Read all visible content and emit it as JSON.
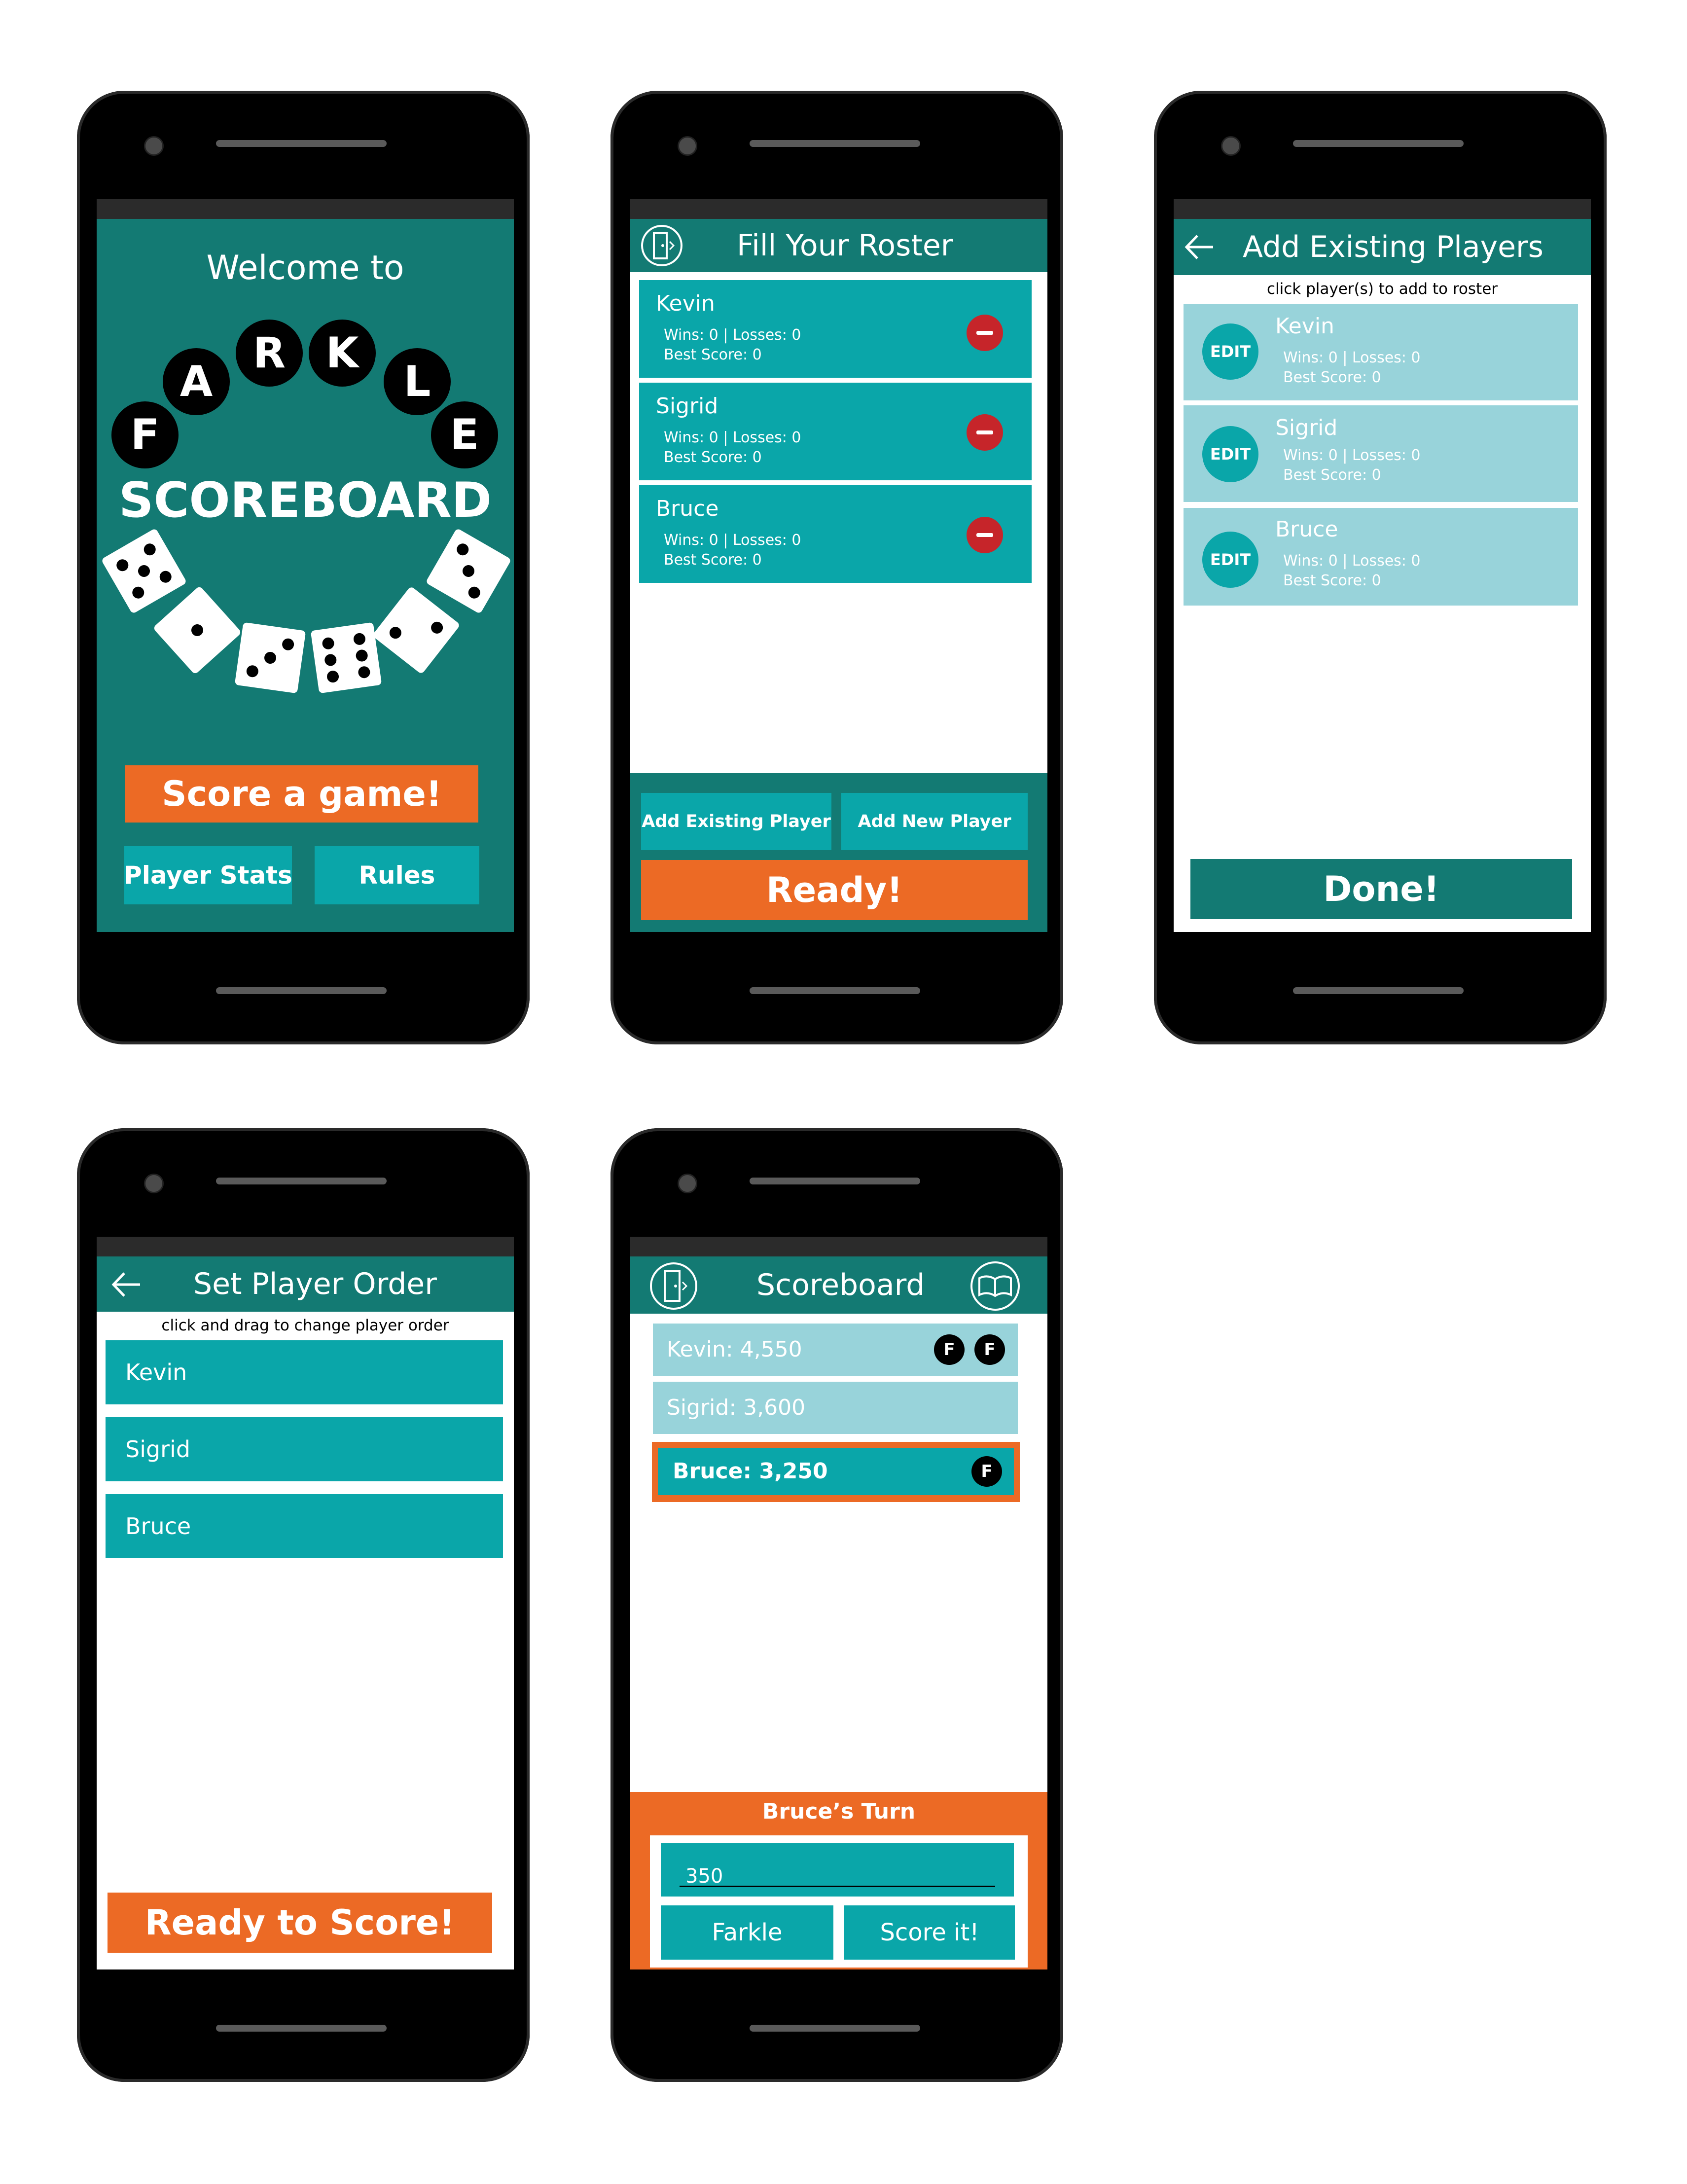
{
  "screens": {
    "welcome": {
      "welcome_text": "Welcome to",
      "letters": [
        "F",
        "A",
        "R",
        "K",
        "L",
        "E"
      ],
      "scoreboard_text": "SCOREBOARD",
      "score_button": "Score a game!",
      "stats_button": "Player Stats",
      "rules_button": "Rules"
    },
    "roster": {
      "title": "Fill Your Roster",
      "players": [
        {
          "name": "Kevin",
          "record": "Wins: 0   |   Losses: 0",
          "best": "Best Score: 0"
        },
        {
          "name": "Sigrid",
          "record": "Wins: 0   |   Losses: 0",
          "best": "Best Score: 0"
        },
        {
          "name": "Bruce",
          "record": "Wins: 0   |   Losses: 0",
          "best": "Best Score: 0"
        }
      ],
      "add_existing": "Add Existing Player",
      "add_new": "Add New Player",
      "ready": "Ready!"
    },
    "add_existing": {
      "title": "Add Existing Players",
      "hint": "click player(s) to add to roster",
      "edit_label": "EDIT",
      "players": [
        {
          "name": "Kevin",
          "record": "Wins: 0   |   Losses: 0",
          "best": "Best Score: 0"
        },
        {
          "name": "Sigrid",
          "record": "Wins: 0   |   Losses: 0",
          "best": "Best Score: 0"
        },
        {
          "name": "Bruce",
          "record": "Wins: 0   |   Losses: 0",
          "best": "Best Score: 0"
        }
      ],
      "done": "Done!"
    },
    "order": {
      "title": "Set Player Order",
      "hint": "click and drag to change player order",
      "players": [
        "Kevin",
        "Sigrid",
        "Bruce"
      ],
      "ready": "Ready to Score!"
    },
    "scoreboard": {
      "title": "Scoreboard",
      "rows": [
        {
          "label": "Kevin: 4,550",
          "badges": [
            "F",
            "F"
          ]
        },
        {
          "label": "Sigrid: 3,600",
          "badges": []
        },
        {
          "label": "Bruce: 3,250",
          "badges": [
            "F"
          ]
        }
      ],
      "turn_label": "Bruce’s Turn",
      "input_value": "350",
      "farkle_button": "Farkle",
      "score_button": "Score it!"
    }
  },
  "colors": {
    "teal_dark": "#137a73",
    "teal": "#0aa6a9",
    "teal_light": "#98d3da",
    "orange": "#ec6a25",
    "remove_red": "#c6252a"
  },
  "icons": [
    "exit-door-icon",
    "back-arrow-icon",
    "rules-book-icon",
    "remove-player-icon"
  ]
}
